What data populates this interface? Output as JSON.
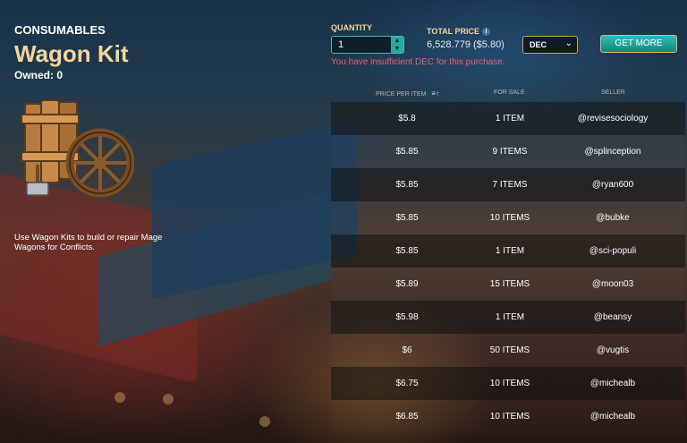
{
  "item": {
    "category": "CONSUMABLES",
    "title": "Wagon Kit",
    "owned": "Owned: 0",
    "description": "Use Wagon Kits to build or repair Mage Wagons for Conflicts."
  },
  "purchase": {
    "quantity_label": "QUANTITY",
    "quantity_value": "1",
    "total_label": "TOTAL PRICE",
    "total_value": "6,528.779 ($5.80)",
    "error": "You have insufficient DEC for this purchase.",
    "currency": "DEC",
    "get_more": "GET MORE"
  },
  "table": {
    "headers": {
      "price": "PRICE PER ITEM",
      "for_sale": "FOR SALE",
      "seller": "SELLER"
    },
    "rows": [
      {
        "price": "$5.8",
        "for_sale": "1 ITEM",
        "seller": "@revisesociology"
      },
      {
        "price": "$5.85",
        "for_sale": "9 ITEMS",
        "seller": "@splinception"
      },
      {
        "price": "$5.85",
        "for_sale": "7 ITEMS",
        "seller": "@ryan600"
      },
      {
        "price": "$5.85",
        "for_sale": "10 ITEMS",
        "seller": "@bubke"
      },
      {
        "price": "$5.85",
        "for_sale": "1 ITEM",
        "seller": "@sci-populi"
      },
      {
        "price": "$5.89",
        "for_sale": "15 ITEMS",
        "seller": "@moon03"
      },
      {
        "price": "$5.98",
        "for_sale": "1 ITEM",
        "seller": "@beansy"
      },
      {
        "price": "$6",
        "for_sale": "50 ITEMS",
        "seller": "@vugtis"
      },
      {
        "price": "$6.75",
        "for_sale": "10 ITEMS",
        "seller": "@michealb"
      },
      {
        "price": "$6.85",
        "for_sale": "10 ITEMS",
        "seller": "@michealb"
      }
    ]
  },
  "colors": {
    "accent": "#2aa99c",
    "gold": "#f4d69a",
    "error": "#ef5f6e"
  },
  "icons": {
    "info": "info-icon",
    "sort": "sort-icon",
    "chevron": "chevron-down-icon",
    "stepper_up": "chevron-up-icon",
    "stepper_down": "chevron-down-icon"
  }
}
